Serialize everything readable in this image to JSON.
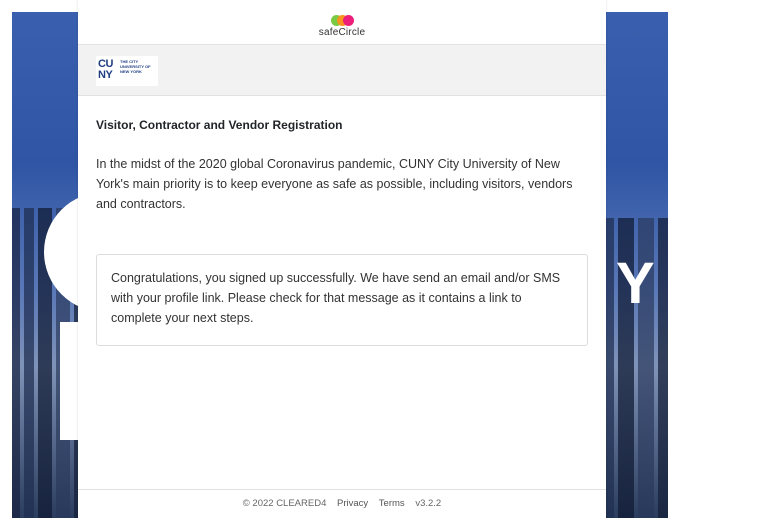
{
  "brand": {
    "name": "safeCircle",
    "dot_colors": [
      "#7ac943",
      "#f7931e",
      "#ed1e79"
    ]
  },
  "institution": {
    "logo_mark": "CU NY",
    "logo_subtext": "THE CITY UNIVERSITY OF NEW YORK"
  },
  "background": {
    "letter": "Y"
  },
  "main": {
    "title": "Visitor, Contractor and Vendor Registration",
    "intro": "In the midst of the 2020 global Coronavirus pandemic, CUNY City University of New York's main priority is to keep everyone as safe as possible, including visitors, vendors and contractors.",
    "success_message": "Congratulations, you signed up successfully. We have send an email and/or SMS with your profile link. Please check for that message as it contains a link to complete your next steps."
  },
  "footer": {
    "copyright": "© 2022 CLEARED4",
    "privacy": "Privacy",
    "terms": "Terms",
    "version": "v3.2.2"
  }
}
